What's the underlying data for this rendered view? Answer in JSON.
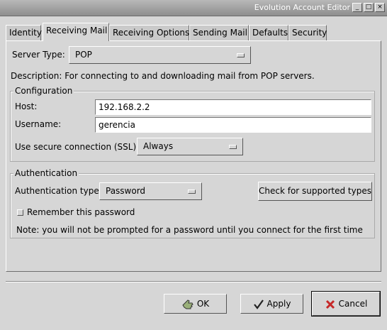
{
  "window": {
    "title": "Evolution Account Editor",
    "controls": {
      "minimize": "_",
      "maximize": "□",
      "close": "×"
    }
  },
  "tabs": [
    {
      "label": "Identity"
    },
    {
      "label": "Receiving Mail"
    },
    {
      "label": "Receiving Options"
    },
    {
      "label": "Sending Mail"
    },
    {
      "label": "Defaults"
    },
    {
      "label": "Security"
    }
  ],
  "server": {
    "type_label": "Server Type:",
    "type_value": "POP",
    "description": "Description: For connecting to and downloading mail from POP servers."
  },
  "configuration": {
    "title": "Configuration",
    "host_label": "Host:",
    "host_value": "192.168.2.2",
    "username_label": "Username:",
    "username_value": "gerencia",
    "ssl_label": "Use secure connection (SSL):",
    "ssl_value": "Always"
  },
  "authentication": {
    "title": "Authentication",
    "type_label": "Authentication type:",
    "type_value": "Password",
    "check_button": "Check for supported types",
    "remember_label": "Remember this password",
    "remember_checked": false,
    "note": "Note: you will not be prompted for a password until you connect for the first time"
  },
  "buttons": {
    "ok": "OK",
    "apply": "Apply",
    "cancel": "Cancel"
  }
}
